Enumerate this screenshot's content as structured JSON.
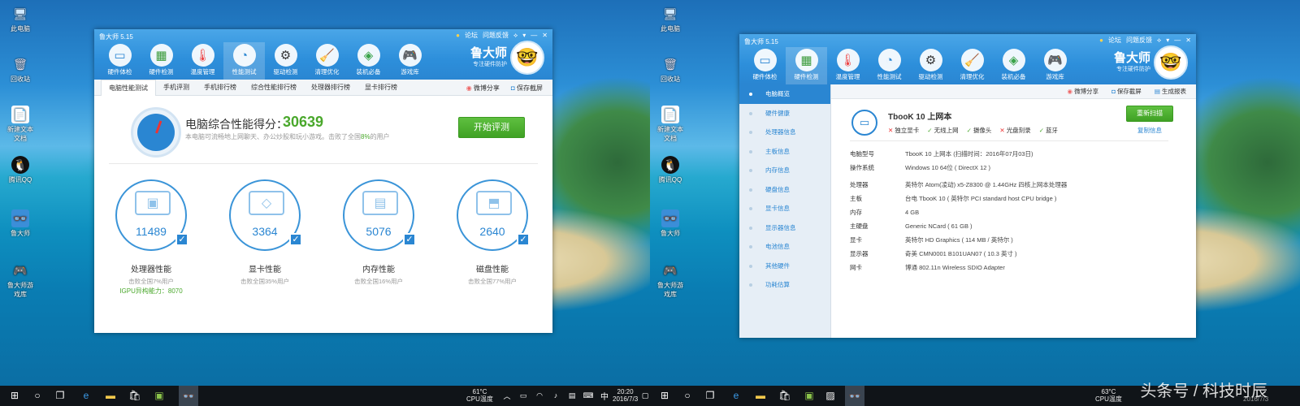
{
  "left": {
    "desktop_icons": [
      "此电脑",
      "回收站",
      "新建文本文档",
      "腾讯QQ",
      "鲁大师",
      "鲁大师游戏库"
    ],
    "window": {
      "title": "鲁大师 5.15",
      "controls": [
        "论坛",
        "问题反馈"
      ],
      "nav": [
        {
          "label": "硬件体检",
          "icon": "monitor-icon"
        },
        {
          "label": "硬件检测",
          "icon": "chip-icon"
        },
        {
          "label": "温度管理",
          "icon": "thermometer-icon"
        },
        {
          "label": "性能测试",
          "icon": "gauge-icon"
        },
        {
          "label": "驱动检测",
          "icon": "driver-icon"
        },
        {
          "label": "清理优化",
          "icon": "broom-icon"
        },
        {
          "label": "装机必备",
          "icon": "cube-icon"
        },
        {
          "label": "游戏库",
          "icon": "gamepad-icon"
        }
      ],
      "brand": {
        "name": "鲁大师",
        "slogan": "专注硬件防护"
      },
      "sub_tabs": [
        "电脑性能测试",
        "手机评测",
        "手机排行榜",
        "综合性能排行榜",
        "处理器排行榜",
        "显卡排行榜"
      ],
      "sub_actions": [
        "微博分享",
        "保存截屏"
      ],
      "score": {
        "title": "电脑综合性能得分：",
        "value": "30639",
        "desc_prefix": "本电脑可流畅地上网聊天、办公炒股和玩小游戏。击败了全国",
        "desc_pct": "8%",
        "desc_suffix": "的用户",
        "button": "开始评测"
      },
      "metrics": [
        {
          "value": "11489",
          "title": "处理器性能",
          "sub": "击败全国7%用户",
          "extra": "IGPU异构能力：8070",
          "icon": "cpu-icon"
        },
        {
          "value": "3364",
          "title": "显卡性能",
          "sub": "击败全国35%用户",
          "extra": "",
          "icon": "gpu-icon"
        },
        {
          "value": "5076",
          "title": "内存性能",
          "sub": "击败全国16%用户",
          "extra": "",
          "icon": "memory-icon"
        },
        {
          "value": "2640",
          "title": "磁盘性能",
          "sub": "击败全国77%用户",
          "extra": "",
          "icon": "disk-icon"
        }
      ]
    },
    "taskbar": {
      "temp": "61°C",
      "temp_label": "CPU温度",
      "time": "20:20",
      "date": "2016/7/3",
      "ime": "中"
    }
  },
  "right": {
    "desktop_icons": [
      "此电脑",
      "回收站",
      "新建文本文档",
      "腾讯QQ",
      "鲁大师",
      "鲁大师游戏库"
    ],
    "window": {
      "title": "鲁大师 5.15",
      "controls": [
        "论坛",
        "问题反馈"
      ],
      "nav": [
        {
          "label": "硬件体检",
          "icon": "monitor-icon"
        },
        {
          "label": "硬件检测",
          "icon": "chip-icon"
        },
        {
          "label": "温度管理",
          "icon": "thermometer-icon"
        },
        {
          "label": "性能测试",
          "icon": "gauge-icon"
        },
        {
          "label": "驱动检测",
          "icon": "driver-icon"
        },
        {
          "label": "清理优化",
          "icon": "broom-icon"
        },
        {
          "label": "装机必备",
          "icon": "cube-icon"
        },
        {
          "label": "游戏库",
          "icon": "gamepad-icon"
        }
      ],
      "brand": {
        "name": "鲁大师",
        "slogan": "专注硬件防护"
      },
      "top_actions": [
        "微博分享",
        "保存截屏",
        "生成报表"
      ],
      "sidebar": [
        "电脑概览",
        "硬件健康",
        "处理器信息",
        "主板信息",
        "内存信息",
        "硬盘信息",
        "显卡信息",
        "显示器信息",
        "电池信息",
        "其他硬件",
        "功耗估算"
      ],
      "device": {
        "name": "TbooK 10 上网本",
        "flags": [
          {
            "ok": false,
            "label": "独立显卡"
          },
          {
            "ok": true,
            "label": "无线上网"
          },
          {
            "ok": true,
            "label": "摄像头"
          },
          {
            "ok": false,
            "label": "光盘刻录"
          },
          {
            "ok": true,
            "label": "蓝牙"
          }
        ],
        "rescan": "重新扫描",
        "copy": "复制信息"
      },
      "specs": [
        {
          "k": "电脑型号",
          "v": "TbooK 10 上网本  (扫描时间：2016年07月03日)"
        },
        {
          "k": "操作系统",
          "v": "Windows 10 64位 ( DirectX 12 )"
        },
        {
          "k": "处理器",
          "v": "英特尔 Atom(凌动) x5-Z8300 @ 1.44GHz 四核上网本处理器"
        },
        {
          "k": "主板",
          "v": "台电 TbooK 10 ( 英特尔 PCI standard host CPU bridge )"
        },
        {
          "k": "内存",
          "v": "4 GB"
        },
        {
          "k": "主硬盘",
          "v": "Generic NCard ( 61 GB )"
        },
        {
          "k": "显卡",
          "v": "英特尔 HD Graphics ( 114 MB / 英特尔 )"
        },
        {
          "k": "显示器",
          "v": "奇美 CMN0001 B101UAN07 ( 10.3 英寸 )"
        },
        {
          "k": "网卡",
          "v": "博通 802.11n Wireless SDIO Adapter"
        }
      ]
    },
    "taskbar": {
      "temp": "63°C",
      "temp_label": "CPU温度",
      "date": "2016/7/3"
    },
    "watermark": "头条号 / 科技时辰"
  }
}
